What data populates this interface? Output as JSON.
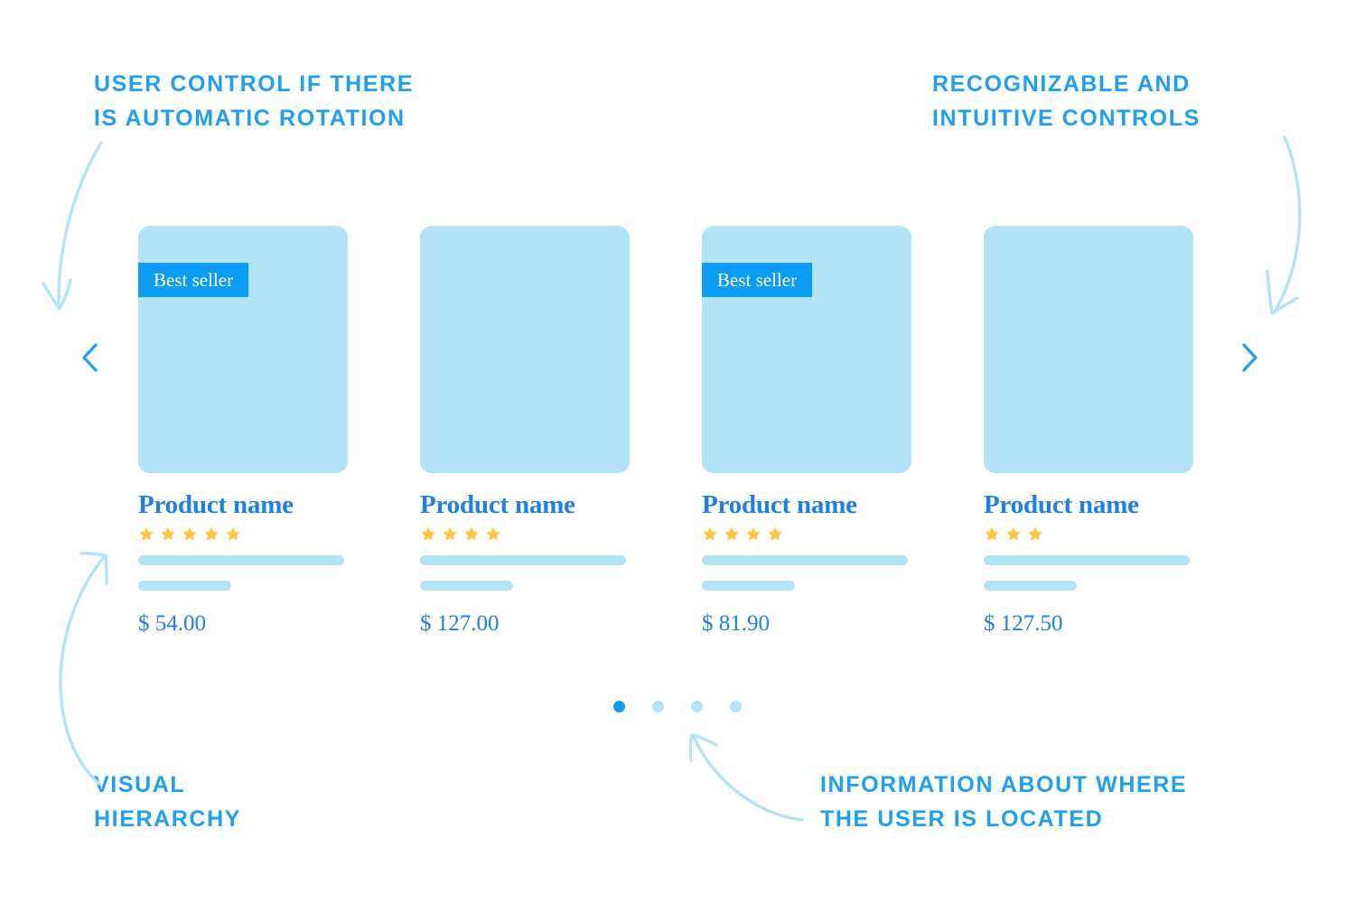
{
  "colors": {
    "accent_blue": "#1E9EF5",
    "badge_blue": "#0C9CF5",
    "text_blue": "#1E7FE8",
    "light_blue": "#B2E4F5",
    "star_yellow": "#FFC740",
    "background": "#FFFFFF"
  },
  "annotations": [
    {
      "id": "user-control",
      "text": "USER CONTROL IF THERE\nIS AUTOMATIC ROTATION"
    },
    {
      "id": "recognizable-controls",
      "text": "RECOGNIZABLE AND\nINTUITIVE CONTROLS"
    },
    {
      "id": "visual-hierarchy",
      "text": "VISUAL\nHIERARCHY"
    },
    {
      "id": "user-location",
      "text": "INFORMATION ABOUT WHERE\nTHE USER IS LOCATED"
    }
  ],
  "carousel": {
    "prev_label": "‹",
    "next_label": "›",
    "badge_label": "Best seller",
    "products": [
      {
        "name": "Product name",
        "rating": 5,
        "price": "$ 54.00",
        "badge": "Best seller",
        "has_badge": true
      },
      {
        "name": "Product name",
        "rating": 4,
        "price": "$ 127.00",
        "badge": "",
        "has_badge": false
      },
      {
        "name": "Product name",
        "rating": 4,
        "price": "$ 81.90",
        "badge": "Best seller",
        "has_badge": true
      },
      {
        "name": "Product name",
        "rating": 3,
        "price": "$ 127.50",
        "badge": "",
        "has_badge": false
      }
    ],
    "pagination": {
      "total": 4,
      "active_index": 0
    }
  }
}
